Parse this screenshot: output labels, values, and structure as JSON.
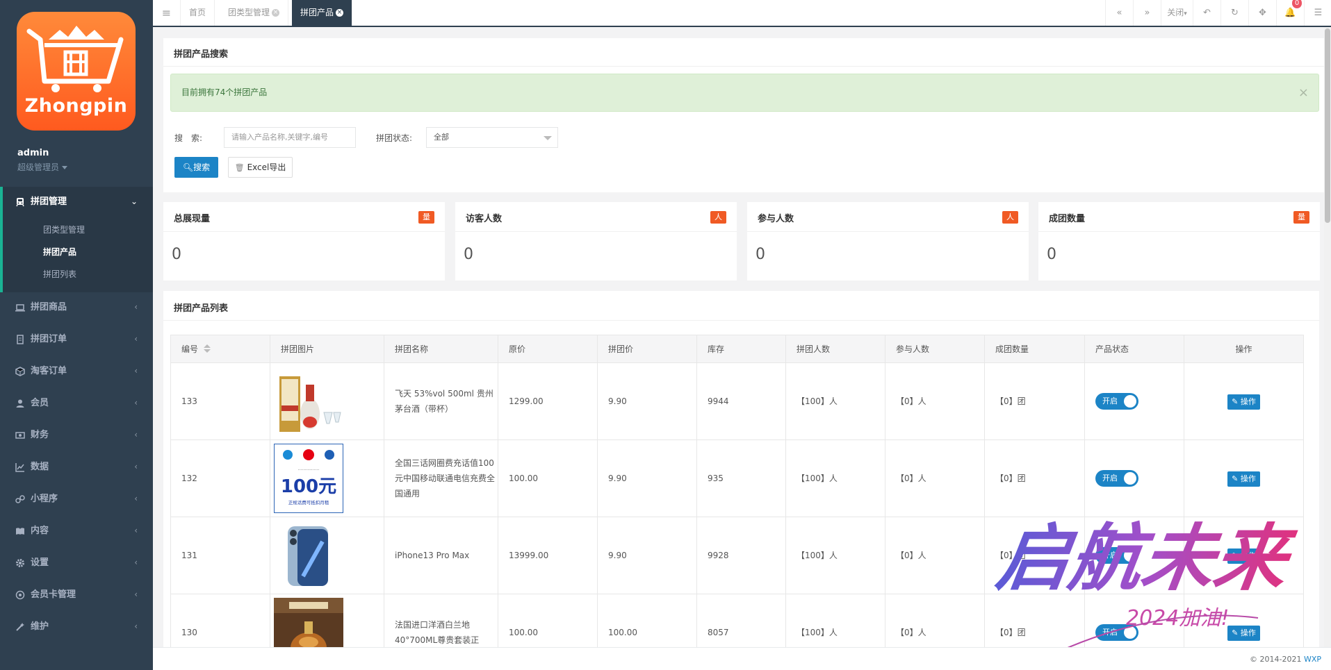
{
  "brand": {
    "logo_text": "Zhongpin"
  },
  "user": {
    "name": "admin",
    "role": "超级管理员"
  },
  "sidebar": {
    "groups": [
      {
        "label": "拼团管理",
        "open": true,
        "items": [
          {
            "label": "团类型管理"
          },
          {
            "label": "拼团产品",
            "active": true
          },
          {
            "label": "拼团列表"
          }
        ]
      },
      {
        "label": "拼团商品"
      },
      {
        "label": "拼团订单"
      },
      {
        "label": "淘客订单"
      },
      {
        "label": "会员"
      },
      {
        "label": "财务"
      },
      {
        "label": "数据"
      },
      {
        "label": "小程序"
      },
      {
        "label": "内容"
      },
      {
        "label": "设置"
      },
      {
        "label": "会员卡管理"
      },
      {
        "label": "维护"
      }
    ]
  },
  "tabs": [
    {
      "label": "首页"
    },
    {
      "label": "团类型管理"
    },
    {
      "label": "拼团产品",
      "active": true
    }
  ],
  "toolbar": {
    "close_label": "关闭",
    "notifications": "0"
  },
  "search_panel": {
    "title": "拼团产品搜索",
    "alert": "目前拥有74个拼团产品",
    "search_label": "搜　索:",
    "search_placeholder": "请输入产品名称,关键字,编号",
    "status_label": "拼团状态:",
    "status_value": "全部",
    "search_button": "搜索",
    "export_button": "Excel导出"
  },
  "stats": [
    {
      "title": "总展现量",
      "badge": "量",
      "value": "0"
    },
    {
      "title": "访客人数",
      "badge": "人",
      "value": "0"
    },
    {
      "title": "参与人数",
      "badge": "人",
      "value": "0"
    },
    {
      "title": "成团数量",
      "badge": "量",
      "value": "0"
    }
  ],
  "list_panel": {
    "title": "拼团产品列表",
    "columns": [
      "编号",
      "拼团图片",
      "拼团名称",
      "原价",
      "拼团价",
      "库存",
      "拼团人数",
      "参与人数",
      "成团数量",
      "产品状态",
      "操作"
    ],
    "rows": [
      {
        "id": "133",
        "name": "飞天 53%vol 500ml 贵州茅台酒（带杯）",
        "price": "1299.00",
        "group_price": "9.90",
        "stock": "9944",
        "group_size": "【100】人",
        "joined": "【0】人",
        "success": "【0】团",
        "status": "开启",
        "action": "操作"
      },
      {
        "id": "132",
        "name": "全国三话网圈费充话值100元中国移动联通电信充费全国通用",
        "price": "100.00",
        "group_price": "9.90",
        "stock": "935",
        "group_size": "【100】人",
        "joined": "【0】人",
        "success": "【0】团",
        "status": "开启",
        "action": "操作"
      },
      {
        "id": "131",
        "name": "iPhone13 Pro Max",
        "price": "13999.00",
        "group_price": "9.90",
        "stock": "9928",
        "group_size": "【100】人",
        "joined": "【0】人",
        "success": "【0】团",
        "status": "开启",
        "action": "操作"
      },
      {
        "id": "130",
        "name": "法国进口洋酒白兰地40°700ML尊贵套装正",
        "price": "100.00",
        "group_price": "100.00",
        "stock": "8057",
        "group_size": "【100】人",
        "joined": "【0】人",
        "success": "【0】团",
        "status": "开启",
        "action": "操作"
      }
    ]
  },
  "thumb_texts": {
    "recharge_amount": "100元",
    "recharge_sub": "正规话费可抵扣月租"
  },
  "footer": {
    "copyright": "© 2014-2021",
    "link": "WXP"
  },
  "watermark": {
    "main": "启航未来",
    "sub": "2024加油!"
  },
  "colors": {
    "sidebar_bg": "#2f4050",
    "primary": "#1c84c6",
    "badge": "#f05a24",
    "alert_bg": "#dff0d8"
  }
}
